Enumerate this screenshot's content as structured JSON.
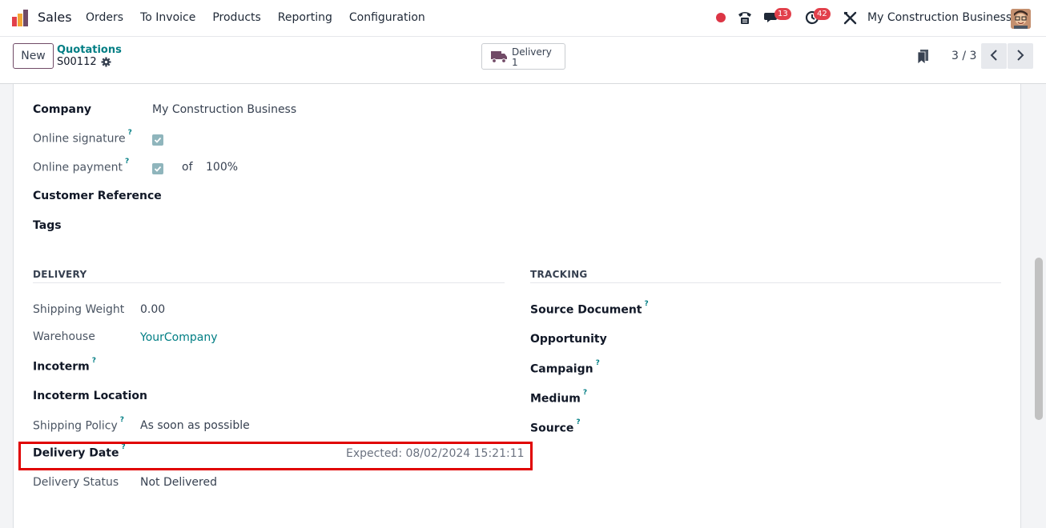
{
  "navbar": {
    "app_name": "Sales",
    "menu": [
      "Orders",
      "To Invoice",
      "Products",
      "Reporting",
      "Configuration"
    ],
    "chat_badge": "13",
    "activity_badge": "42",
    "company": "My Construction Business"
  },
  "control": {
    "new_label": "New",
    "breadcrumb_parent": "Quotations",
    "breadcrumb_current": "S00112",
    "smart_button": {
      "label": "Delivery",
      "value": "1"
    },
    "pager": "3 / 3"
  },
  "form": {
    "company_label": "Company",
    "company_value": "My Construction Business",
    "online_signature_label": "Online signature",
    "online_signature_checked": true,
    "online_payment_label": "Online payment",
    "online_payment_checked": true,
    "online_payment_of": "of",
    "online_payment_percent": "100%",
    "customer_reference_label": "Customer Reference",
    "tags_label": "Tags",
    "delivery": {
      "title": "DELIVERY",
      "shipping_weight_label": "Shipping Weight",
      "shipping_weight_value": "0.00",
      "warehouse_label": "Warehouse",
      "warehouse_value": "YourCompany",
      "incoterm_label": "Incoterm",
      "incoterm_location_label": "Incoterm Location",
      "shipping_policy_label": "Shipping Policy",
      "shipping_policy_value": "As soon as possible",
      "delivery_date_label": "Delivery Date",
      "delivery_date_value": "Expected: 08/02/2024 15:21:11",
      "delivery_status_label": "Delivery Status",
      "delivery_status_value": "Not Delivered"
    },
    "tracking": {
      "title": "TRACKING",
      "source_document_label": "Source Document",
      "opportunity_label": "Opportunity",
      "campaign_label": "Campaign",
      "medium_label": "Medium",
      "source_label": "Source"
    }
  },
  "colors": {
    "accent": "#017e84",
    "brand": "#714b67",
    "badge": "#e2404b",
    "highlight": "#e00000"
  }
}
